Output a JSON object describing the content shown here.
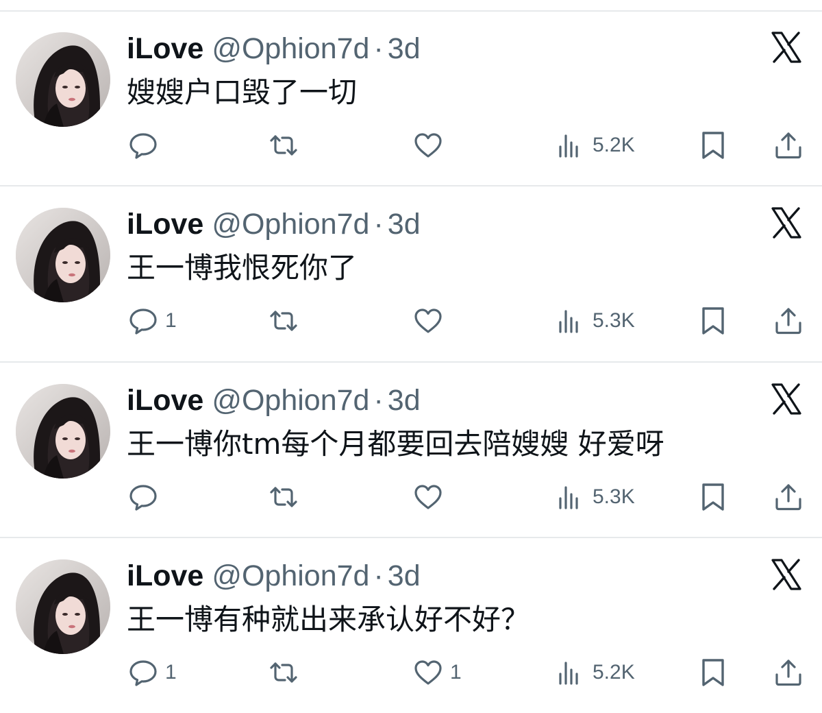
{
  "colors": {
    "text_primary": "#0f1419",
    "text_secondary": "#536471",
    "divider": "#e6e9eb"
  },
  "icons": {
    "reply": "speech-bubble",
    "retweet": "retweet-arrows",
    "like": "heart-outline",
    "views": "bar-chart",
    "bookmark": "bookmark-outline",
    "share": "upload-arrow",
    "brand": "x-logo"
  },
  "tweets": [
    {
      "name": "iLove",
      "handle": "@Ophion7d",
      "separator": "·",
      "time": "3d",
      "text": "嫂嫂户口毁了一切",
      "replies": "",
      "likes": "",
      "views": "5.2K"
    },
    {
      "name": "iLove",
      "handle": "@Ophion7d",
      "separator": "·",
      "time": "3d",
      "text": "王一博我恨死你了",
      "replies": "1",
      "likes": "",
      "views": "5.3K"
    },
    {
      "name": "iLove",
      "handle": "@Ophion7d",
      "separator": "·",
      "time": "3d",
      "text": "王一博你tm每个月都要回去陪嫂嫂 好爱呀",
      "replies": "",
      "likes": "",
      "views": "5.3K"
    },
    {
      "name": "iLove",
      "handle": "@Ophion7d",
      "separator": "·",
      "time": "3d",
      "text": "王一博有种就出来承认好不好？",
      "replies": "1",
      "likes": "1",
      "views": "5.2K"
    }
  ]
}
